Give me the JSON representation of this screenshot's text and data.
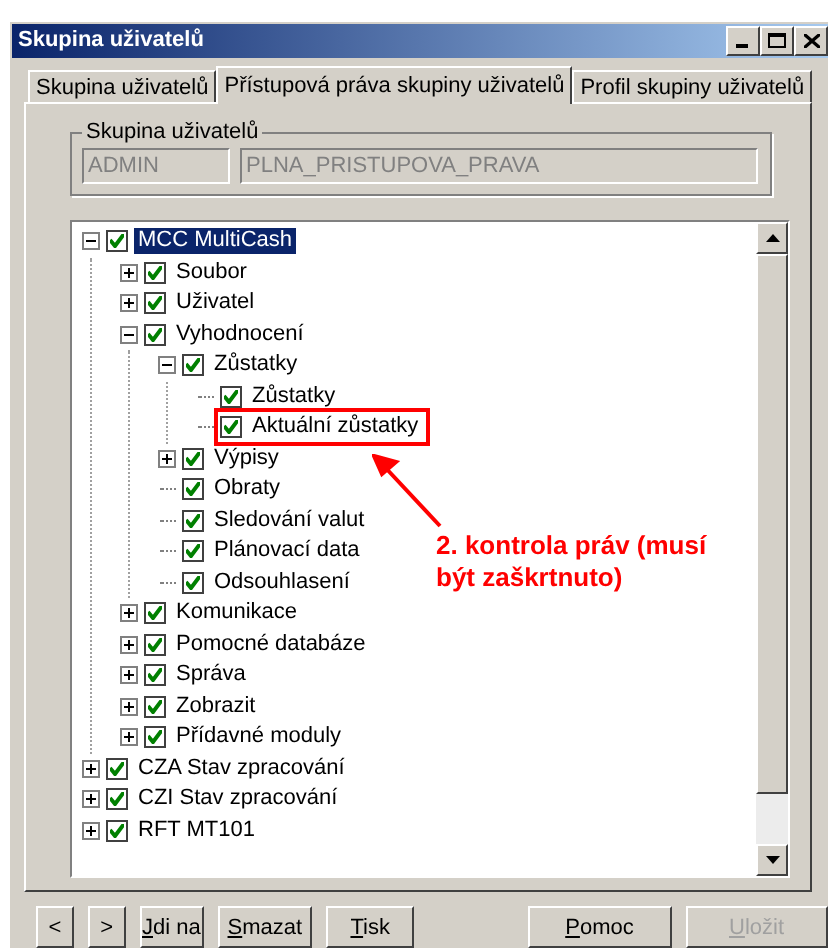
{
  "window": {
    "title": "Skupina uživatelů"
  },
  "tabs": [
    {
      "label": "Skupina uživatelů",
      "selected": false
    },
    {
      "label": "Přístupová práva skupiny uživatelů",
      "selected": true
    },
    {
      "label": "Profil skupiny uživatelů",
      "selected": false
    }
  ],
  "group": {
    "title": "Skupina uživatelů",
    "fields": [
      {
        "value": "ADMIN",
        "disabled": true
      },
      {
        "value": "PLNA_PRISTUPOVA_PRAVA",
        "disabled": true
      }
    ]
  },
  "tree": [
    {
      "label": "MCC MultiCash",
      "checked": true,
      "expanded": true,
      "selected": true,
      "children": [
        {
          "label": "Soubor",
          "checked": true,
          "expanded": false,
          "selected": false
        },
        {
          "label": "Uživatel",
          "checked": true,
          "expanded": false,
          "selected": false
        },
        {
          "label": "Vyhodnocení",
          "checked": true,
          "expanded": true,
          "selected": false,
          "children": [
            {
              "label": "Zůstatky",
              "checked": true,
              "expanded": true,
              "selected": false,
              "children": [
                {
                  "label": "Zůstatky",
                  "checked": true,
                  "selected": false
                },
                {
                  "label": "Aktuální zůstatky",
                  "checked": true,
                  "selected": false,
                  "annotated": true
                }
              ]
            },
            {
              "label": "Výpisy",
              "checked": true,
              "expanded": false,
              "selected": false
            },
            {
              "label": "Obraty",
              "checked": true,
              "selected": false
            },
            {
              "label": "Sledování valut",
              "checked": true,
              "selected": false
            },
            {
              "label": "Plánovací data",
              "checked": true,
              "selected": false
            },
            {
              "label": "Odsouhlasení",
              "checked": true,
              "selected": false
            }
          ]
        },
        {
          "label": "Komunikace",
          "checked": true,
          "expanded": false,
          "selected": false
        },
        {
          "label": "Pomocné databáze",
          "checked": true,
          "expanded": false,
          "selected": false
        },
        {
          "label": "Správa",
          "checked": true,
          "expanded": false,
          "selected": false
        },
        {
          "label": "Zobrazit",
          "checked": true,
          "expanded": false,
          "selected": false
        },
        {
          "label": "Přídavné moduly",
          "checked": true,
          "expanded": false,
          "selected": false
        }
      ]
    },
    {
      "label": "CZA Stav zpracování",
      "checked": true,
      "expanded": false,
      "selected": false
    },
    {
      "label": "CZI Stav zpracování",
      "checked": true,
      "expanded": false,
      "selected": false
    },
    {
      "label": "RFT MT101",
      "checked": true,
      "expanded": false,
      "selected": false
    }
  ],
  "annotation": {
    "text": "2. kontrola práv (musí být zaškrtnuto)"
  },
  "buttons": [
    {
      "label": "<",
      "kind": "nav",
      "disabled": false
    },
    {
      "label": ">",
      "kind": "nav",
      "disabled": false
    },
    {
      "label": "Jdi na",
      "kind": "text",
      "disabled": false
    },
    {
      "label": "Smazat",
      "kind": "text",
      "disabled": false
    },
    {
      "label": "Tisk",
      "kind": "text",
      "disabled": false
    },
    {
      "label": "Pomoc",
      "kind": "wide",
      "disabled": false
    },
    {
      "label": "Uložit",
      "kind": "wide",
      "disabled": true
    }
  ]
}
